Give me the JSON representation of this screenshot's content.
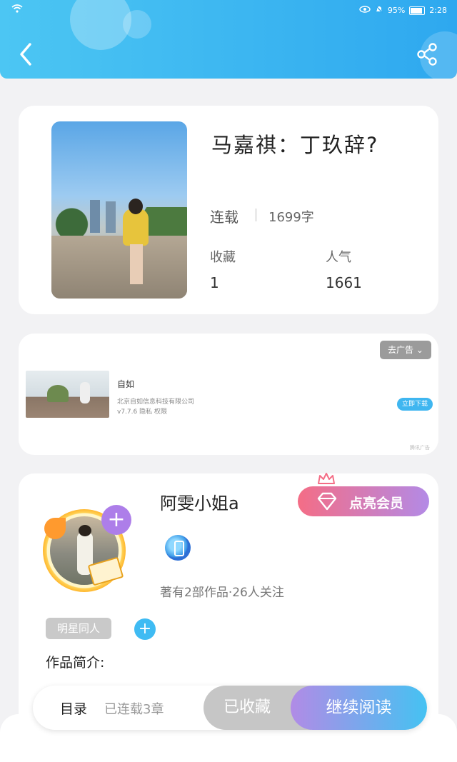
{
  "status_bar": {
    "battery": "95%",
    "time": "2:28"
  },
  "book": {
    "title": "马嘉祺：丁玖辞?",
    "status": "连载",
    "word_count": "1699字",
    "favorites_label": "收藏",
    "favorites_value": "1",
    "popularity_label": "人气",
    "popularity_value": "1661"
  },
  "ad": {
    "remove_label": "去广告",
    "app_name": "自如",
    "company": "北京自如信息科技有限公司",
    "version": "v7.7.6 隐私 权限",
    "download_label": "立即下载",
    "tag": "腾讯广告"
  },
  "author": {
    "name": "阿雯小姐a",
    "vip_label": "点亮会员",
    "stats": "著有2部作品·26人关注",
    "tag": "明星同人",
    "intro_label": "作品简介:"
  },
  "actions": {
    "toc_label": "目录",
    "toc_count": "已连载3章",
    "collected_label": "已收藏",
    "continue_label": "继续阅读"
  },
  "colors": {
    "header": "#2ea8ef",
    "vip_start": "#f46d86",
    "vip_end": "#b38ae6",
    "read_start": "#b18be6",
    "read_end": "#45c2f2"
  }
}
